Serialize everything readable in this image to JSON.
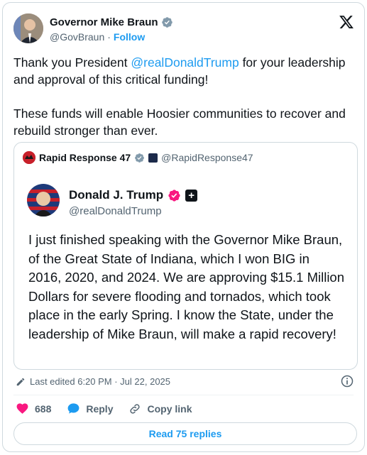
{
  "author": {
    "name": "Governor Mike Braun",
    "handle": "@GovBraun",
    "separator": "·",
    "follow_label": "Follow"
  },
  "tweet": {
    "text_part1_prefix": "Thank you President ",
    "mention": "@realDonaldTrump",
    "text_part1_suffix": " for your leadership and approval of this critical funding!",
    "text_part2": "These funds will enable Hoosier communities to recover and rebuild stronger than ever."
  },
  "quote": {
    "author_name": "Rapid Response 47",
    "author_handle": "@RapidResponse47",
    "embedded_name": "Donald J. Trump",
    "embedded_handle": "@realDonaldTrump",
    "embedded_badge": "+",
    "embedded_text": "I just finished speaking with the Governor Mike Braun, of the Great State of Indiana, which I won BIG in 2016, 2020, and 2024. We are approving $15.1 Million Dollars for severe flooding and tornados, which took place in the early Spring. I know the State, under the leadership of Mike Braun, will make a rapid recovery!"
  },
  "meta": {
    "edited": "Last edited 6:20 PM · Jul 22, 2025"
  },
  "actions": {
    "like_count": "688",
    "reply_label": "Reply",
    "copy_label": "Copy link"
  },
  "footer": {
    "read_replies": "Read 75 replies"
  },
  "colors": {
    "accent": "#1d9bf0",
    "like": "#f91880",
    "verified_gov": "#829aab"
  },
  "icons": [
    "verified-badge-icon",
    "x-logo-icon",
    "pencil-icon",
    "info-icon",
    "heart-icon",
    "speech-bubble-icon",
    "link-icon"
  ]
}
